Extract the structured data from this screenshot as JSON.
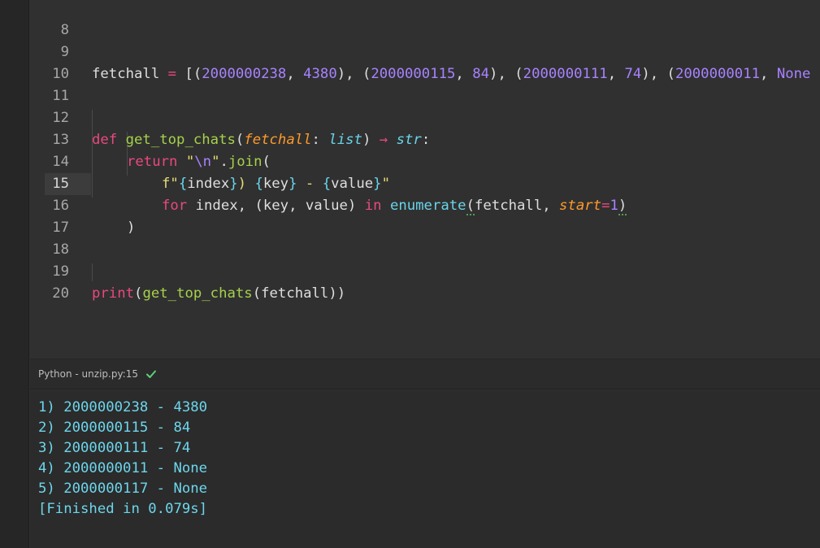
{
  "editor": {
    "lines": [
      {
        "num": "8"
      },
      {
        "num": "9"
      },
      {
        "num": "10"
      },
      {
        "num": "11"
      },
      {
        "num": "12"
      },
      {
        "num": "13"
      },
      {
        "num": "14"
      },
      {
        "num": "15",
        "current": true
      },
      {
        "num": "16"
      },
      {
        "num": "17"
      },
      {
        "num": "18"
      },
      {
        "num": "19"
      },
      {
        "num": "20"
      }
    ],
    "tokens": {
      "l9_var": "fetchall",
      "l9_eq": " = ",
      "l9_open": "[(",
      "l9_n1": "2000000238",
      "l9_c1": ", ",
      "l9_n2": "4380",
      "l9_sep1": "), (",
      "l9_n3": "2000000115",
      "l9_c2": ", ",
      "l9_n4": "84",
      "l9_sep2": "), (",
      "l9_n5": "2000000111",
      "l9_c3": ", ",
      "l9_n6": "74",
      "l9_sep3": "), (",
      "l9_n7": "2000000011",
      "l9_c4": ", ",
      "l9_none": "None",
      "l12_def": "def",
      "l12_fn": "get_top_chats",
      "l12_open": "(",
      "l12_param": "fetchall",
      "l12_colon": ": ",
      "l12_type": "list",
      "l12_close": ") ",
      "l12_arrow": "→",
      "l12_ret": "str",
      "l12_end": ":",
      "l13_return": "return",
      "l13_q1": "\"",
      "l13_esc": "\\n",
      "l13_q2": "\"",
      "l13_dot": ".",
      "l13_join": "join",
      "l13_paren": "(",
      "l14_f": "f\"",
      "l14_b1o": "{",
      "l14_index": "index",
      "l14_b1c": "}",
      "l14_s1": ") ",
      "l14_b2o": "{",
      "l14_key": "key",
      "l14_b2c": "}",
      "l14_s2": " - ",
      "l14_b3o": "{",
      "l14_value": "value",
      "l14_b3c": "}",
      "l14_q": "\"",
      "l15_for": "for",
      "l15_vars": " index, (key, value) ",
      "l15_in": "in",
      "l15_sp": " ",
      "l15_enum": "enumerate",
      "l15_open": "(",
      "l15_arg": "fetchall, ",
      "l15_kw": "start",
      "l15_eq": "=",
      "l15_one": "1",
      "l15_close": ")",
      "l16_close": ")",
      "l19_print": "print",
      "l19_open": "(",
      "l19_fn": "get_top_chats",
      "l19_rest": "(fetchall))"
    }
  },
  "panel": {
    "title": "Python - unzip.py:15",
    "status_icon": "check-icon",
    "output": [
      "1) 2000000238 - 4380",
      "2) 2000000115 - 84",
      "3) 2000000111 - 74",
      "4) 2000000011 - None",
      "5) 2000000117 - None",
      "[Finished in 0.079s]"
    ]
  },
  "colors": {
    "keyword": "#e8497e",
    "function": "#a6d14b",
    "number": "#a882ff",
    "string": "#e6db74",
    "param": "#fd9a2a",
    "type": "#69d4ea",
    "output_text": "#6dd6ec",
    "success_check": "#5fcf7a"
  }
}
